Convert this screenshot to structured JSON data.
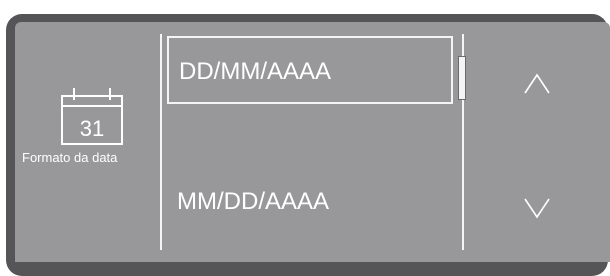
{
  "setting": {
    "icon": "calendar-icon",
    "calendar_day": "31",
    "label": "Formato da data"
  },
  "options": [
    {
      "label": "DD/MM/AAAA",
      "selected": true
    },
    {
      "label": "MM/DD/AAAA",
      "selected": false
    }
  ],
  "controls": {
    "up_icon": "chevron-up-icon",
    "down_icon": "chevron-down-icon"
  },
  "colors": {
    "screen": "#98989b",
    "bezel": "#555557",
    "foreground": "#ffffff"
  }
}
